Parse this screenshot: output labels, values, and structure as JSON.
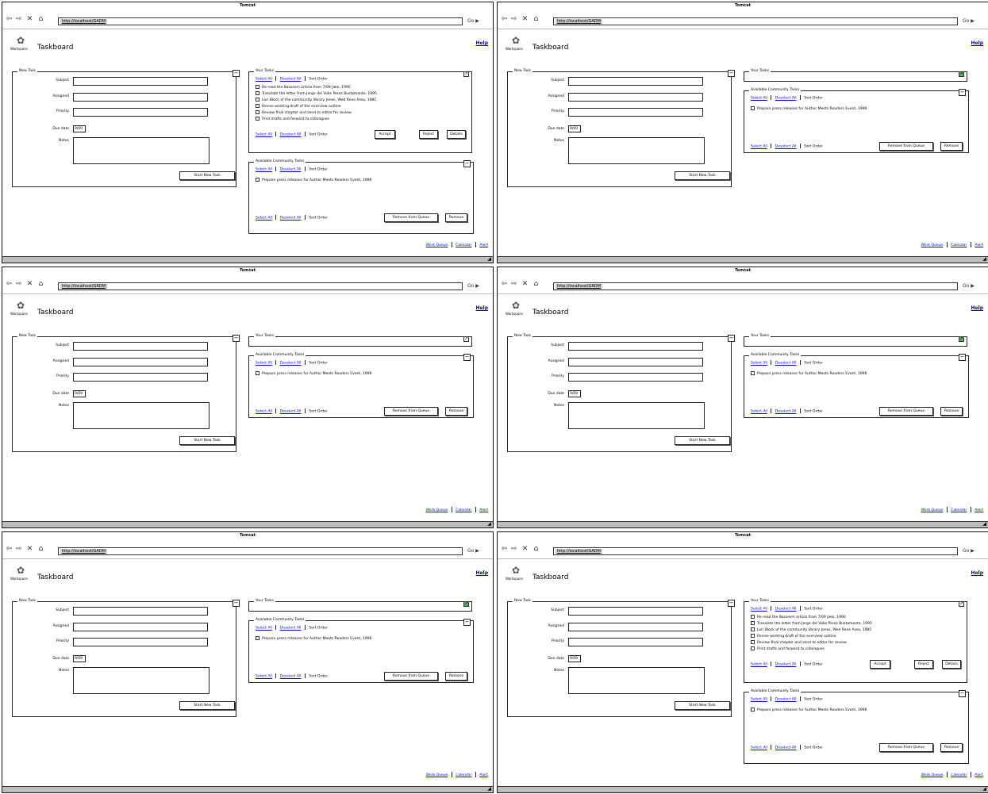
{
  "window": {
    "title": "Tomcat",
    "url": "http://localhost/GADM",
    "go_label": "Go"
  },
  "app": {
    "logo_text": "Workspace",
    "page_title": "Taskboard",
    "help_label": "Help"
  },
  "new_task": {
    "legend": "New Task",
    "fields": {
      "subject": "Subject",
      "assigned": "Assigned",
      "priority": "Priority",
      "due": "Due date",
      "notes": "Notes"
    },
    "due_value": "9/09",
    "start_button": "Start New Task"
  },
  "personal": {
    "legend": "Your Tasks",
    "head": {
      "select_all": "Select All",
      "deselect_all": "Deselect All",
      "sort_label": "Sort Order"
    },
    "tasks": [
      "Re-read the Bassesm article from 7/09 Jake, 1990",
      "Translate the letter from Jorge del Valle Perez Bustamante, 1995",
      "Lori Block of the community library Jones, Wed Reno Area, 1985",
      "Revise working draft of the overview outline",
      "Review final chapter and send to editor for review",
      "Print drafts and forward to colleagues"
    ],
    "actions": {
      "accept": "Accept",
      "reject": "Reject",
      "details": "Details"
    }
  },
  "unclaimed": {
    "legend": "Available Community Tasks",
    "head": {
      "select_all": "Select All",
      "deselect_all": "Deselect All",
      "sort_label": "Sort Order"
    },
    "tasks": [
      "Prepare press releases for Author Meets Readers Event, 1996"
    ],
    "actions": {
      "claim": "Remove from Queue",
      "remove": "Remove"
    }
  },
  "footer": {
    "links": [
      "Work Queue",
      "Calendar",
      "Alert"
    ]
  }
}
